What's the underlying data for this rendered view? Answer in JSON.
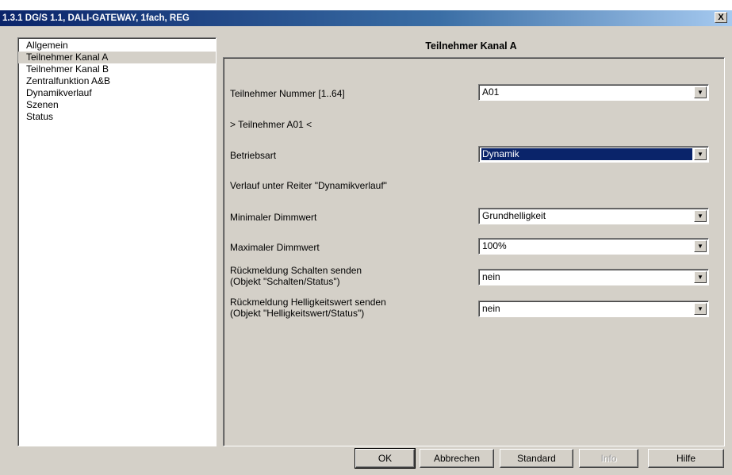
{
  "window": {
    "title": "1.3.1 DG/S 1.1, DALI-GATEWAY, 1fach, REG",
    "close_label": "X"
  },
  "sidebar": {
    "items": [
      {
        "label": "Allgemein",
        "selected": false
      },
      {
        "label": "Teilnehmer Kanal A",
        "selected": true
      },
      {
        "label": "Teilnehmer Kanal B",
        "selected": false
      },
      {
        "label": "Zentralfunktion A&B",
        "selected": false
      },
      {
        "label": "Dynamikverlauf",
        "selected": false
      },
      {
        "label": "Szenen",
        "selected": false
      },
      {
        "label": "Status",
        "selected": false
      }
    ]
  },
  "panel": {
    "title": "Teilnehmer Kanal A",
    "teilnehmer_nummer": {
      "label": "Teilnehmer Nummer [1..64]",
      "value": "A01"
    },
    "teilnehmer_info": "> Teilnehmer A01 <",
    "betriebsart": {
      "label": "Betriebsart",
      "value": "Dynamik"
    },
    "verlauf_info": "Verlauf unter Reiter \"Dynamikverlauf\"",
    "min_dimmwert": {
      "label": "Minimaler Dimmwert",
      "value": "Grundhelligkeit"
    },
    "max_dimmwert": {
      "label": "Maximaler Dimmwert",
      "value": "100%"
    },
    "rm_schalten": {
      "label_line1": "Rückmeldung Schalten senden",
      "label_line2": "(Objekt \"Schalten/Status\")",
      "value": "nein"
    },
    "rm_helligkeit": {
      "label_line1": "Rückmeldung Helligkeitswert senden",
      "label_line2": "(Objekt \"Helligkeitswert/Status\")",
      "value": "nein"
    }
  },
  "buttons": {
    "ok": "OK",
    "abbrechen": "Abbrechen",
    "standard": "Standard",
    "info": "Info",
    "hilfe": "Hilfe"
  },
  "icons": {
    "dropdown": "chevron-down-icon",
    "close": "close-icon"
  },
  "colors": {
    "face": "#d4d0c8",
    "selection": "#0a246a"
  }
}
